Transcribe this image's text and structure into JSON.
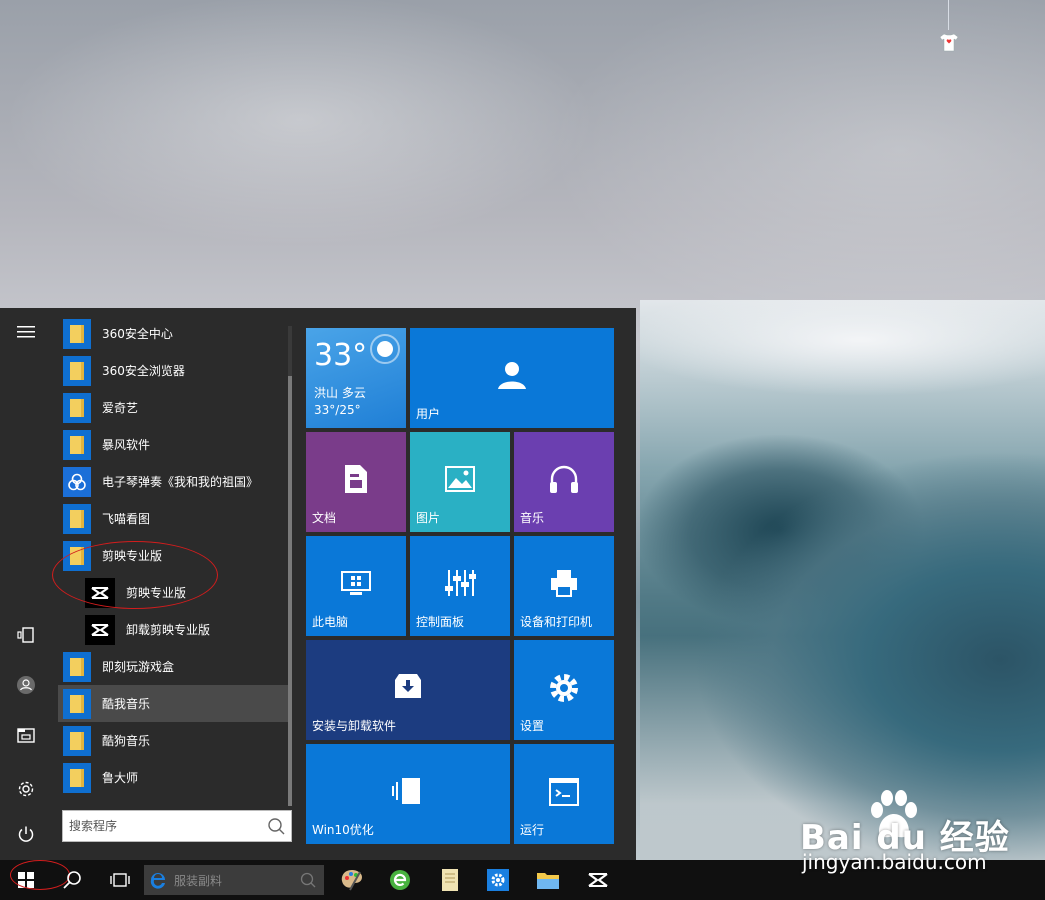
{
  "start_menu": {
    "apps": [
      {
        "label": "360安全中心",
        "icon": "folder-icon"
      },
      {
        "label": "360安全浏览器",
        "icon": "folder-icon"
      },
      {
        "label": "爱奇艺",
        "icon": "folder-icon"
      },
      {
        "label": "暴风软件",
        "icon": "folder-icon"
      },
      {
        "label": "电子琴弹奏《我和我的祖国》",
        "icon": "app-icon"
      },
      {
        "label": "飞喵看图",
        "icon": "folder-icon"
      },
      {
        "label": "剪映专业版",
        "icon": "folder-icon"
      },
      {
        "label": "剪映专业版",
        "icon": "capcut-icon"
      },
      {
        "label": "卸载剪映专业版",
        "icon": "capcut-icon"
      },
      {
        "label": "即刻玩游戏盒",
        "icon": "folder-icon"
      },
      {
        "label": "酷我音乐",
        "icon": "folder-icon"
      },
      {
        "label": "酷狗音乐",
        "icon": "folder-icon"
      },
      {
        "label": "鲁大师",
        "icon": "folder-icon"
      }
    ],
    "search_placeholder": "搜索程序",
    "tiles": {
      "weather": {
        "temp": "33°",
        "location": "洪山",
        "condition": "多云",
        "range": "33°/25°"
      },
      "user": "用户",
      "documents": "文档",
      "pictures": "图片",
      "music": "音乐",
      "this_pc": "此电脑",
      "control_panel": "控制面板",
      "devices": "设备和打印机",
      "install": "安装与卸载软件",
      "settings": "设置",
      "win10opt": "Win10优化",
      "run": "运行"
    }
  },
  "taskbar": {
    "search_text": "服装副料"
  },
  "watermark": {
    "brand": "Bai du 经验",
    "url": "jingyan.baidu.com"
  },
  "colors": {
    "tile_blue": "#0078d7",
    "tile_purple": "#7a3c8a",
    "tile_teal": "#2ab0c4",
    "tile_violet": "#6b3fb0",
    "tile_navy": "#1c3c80",
    "menu_bg": "#2b2b2b"
  }
}
